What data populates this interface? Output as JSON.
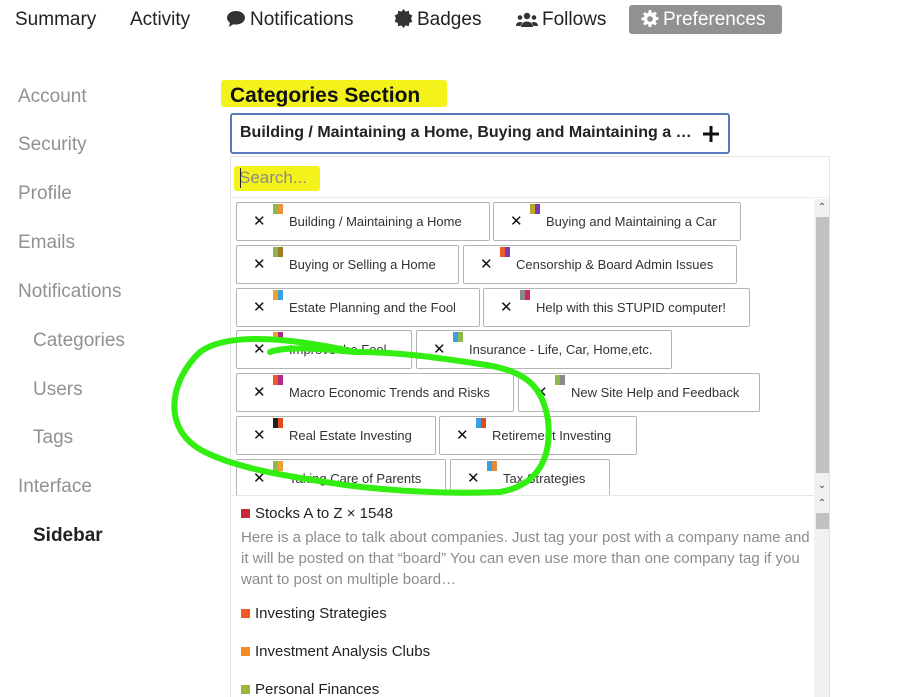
{
  "nav": {
    "summary": "Summary",
    "activity": "Activity",
    "notifications": "Notifications",
    "badges": "Badges",
    "follows": "Follows",
    "preferences": "Preferences"
  },
  "sidebar": {
    "items": [
      "Account",
      "Security",
      "Profile",
      "Emails",
      "Notifications",
      "Categories",
      "Users",
      "Tags",
      "Interface",
      "Sidebar"
    ]
  },
  "section": {
    "title": "Categories Section"
  },
  "selector": {
    "value": "Building / Maintaining a Home, Buying and Maintaining a C..."
  },
  "search": {
    "placeholder": "Search..."
  },
  "chips": [
    {
      "label": "Building / Maintaining a Home",
      "colors": [
        "#8bb94a",
        "#e8923a"
      ]
    },
    {
      "label": "Buying and Maintaining a Car",
      "colors": [
        "#b9a82a",
        "#7b3bb0"
      ]
    },
    {
      "label": "Buying or Selling a Home",
      "colors": [
        "#8bb94a",
        "#a17a2a"
      ]
    },
    {
      "label": "Censorship & Board Admin Issues",
      "colors": [
        "#f05a24",
        "#7b3bb0"
      ]
    },
    {
      "label": "Estate Planning and the Fool",
      "colors": [
        "#f0a030",
        "#3aa0e0"
      ]
    },
    {
      "label": "Help with this STUPID computer!",
      "colors": [
        "#8a8a8a",
        "#c62a5a"
      ]
    },
    {
      "label": "Improve the Fool",
      "colors": [
        "#f0a030",
        "#b02a8a"
      ]
    },
    {
      "label": "Insurance - Life, Car, Home,etc.",
      "colors": [
        "#3aa0e0",
        "#8bb94a"
      ]
    },
    {
      "label": "Macro Economic Trends and Risks",
      "colors": [
        "#f05a24",
        "#b02a8a"
      ]
    },
    {
      "label": "New Site Help and Feedback",
      "colors": [
        "#8bb94a",
        "#8a8a8a"
      ]
    },
    {
      "label": "Real Estate Investing",
      "colors": [
        "#222222",
        "#e24a1a"
      ]
    },
    {
      "label": "Retirement Investing",
      "colors": [
        "#3aa0e0",
        "#e24a1a"
      ]
    },
    {
      "label": "Taking Care of Parents",
      "colors": [
        "#8bb94a",
        "#f0a030"
      ]
    },
    {
      "label": "Tax Strategies",
      "colors": [
        "#3aa0e0",
        "#e88a3a"
      ]
    }
  ],
  "list": {
    "items": [
      {
        "label": "Stocks A to Z × 1548",
        "color": "#c62a3a",
        "description": "Here is a place to talk about companies. Just tag your post with a company name and it will be posted on that “board” You can even use more than one company tag if you want to post on multiple board…"
      },
      {
        "label": "Investing Strategies",
        "color": "#f05a24"
      },
      {
        "label": "Investment Analysis Clubs",
        "color": "#f58a24"
      },
      {
        "label": "Personal Finances",
        "color": "#9ab83a"
      }
    ]
  },
  "colors": {
    "accent_border": "#5b79b9",
    "highlight": "#f3f31b",
    "annotation": "#33ee11",
    "active_tab_bg": "#919191"
  }
}
